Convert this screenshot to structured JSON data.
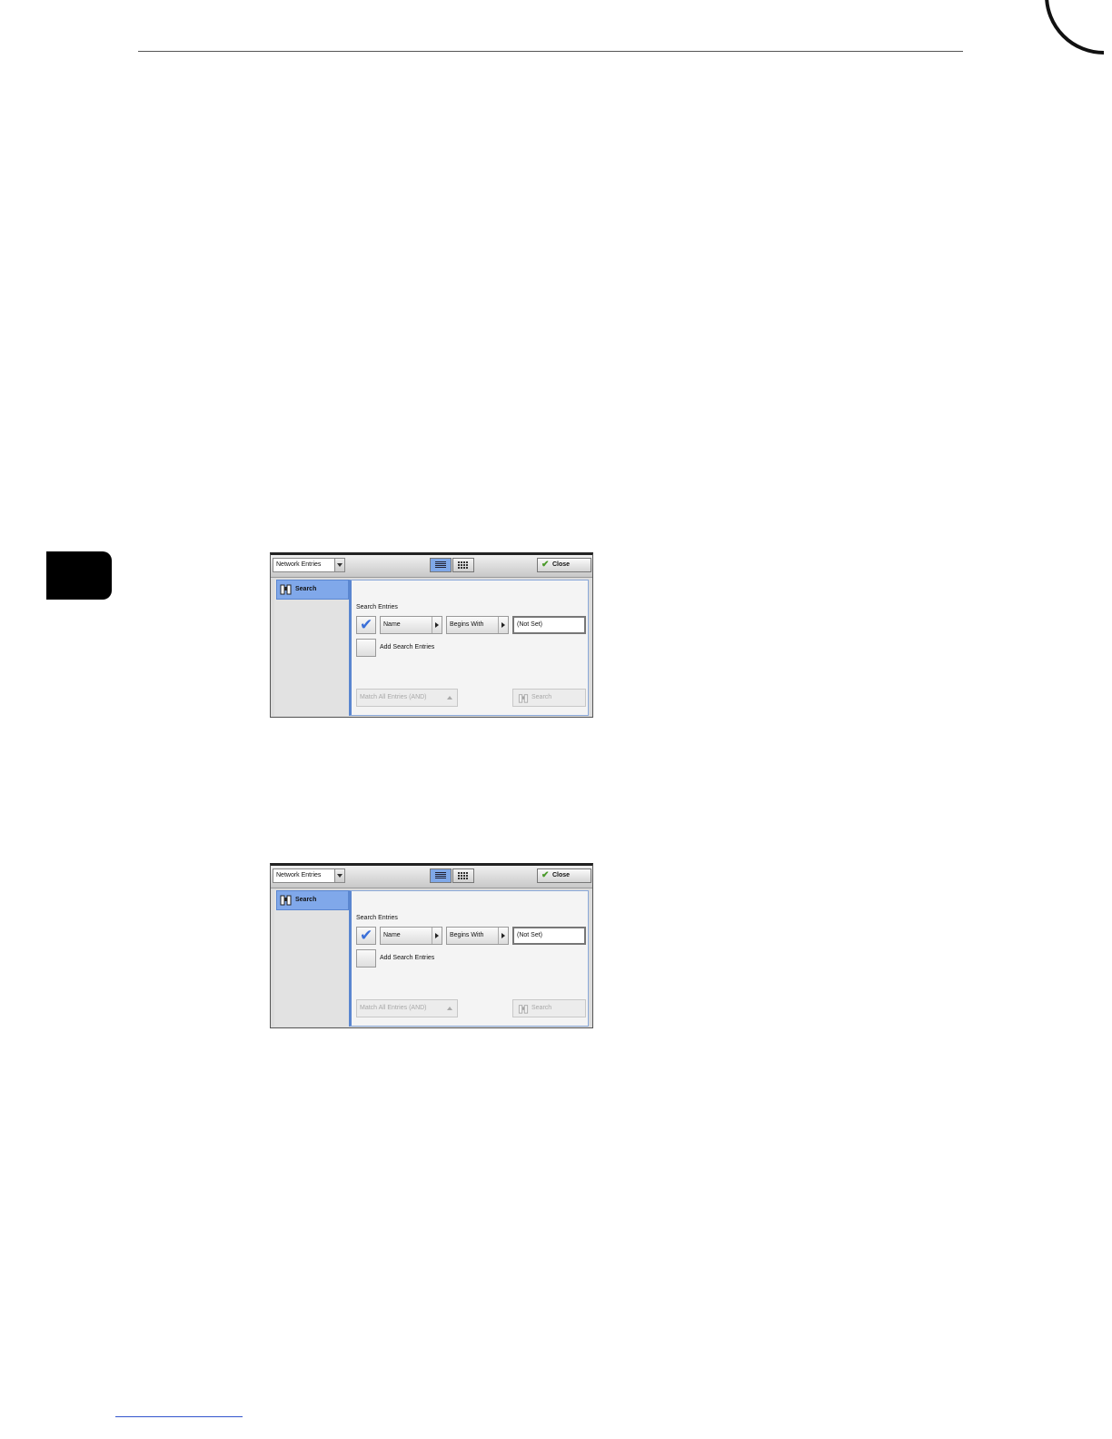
{
  "screens": [
    {
      "dropdown": "Network Entries",
      "close_label": "Close",
      "side_item": "Search",
      "section_title": "Search Entries",
      "field_name": "Name",
      "field_condition": "Begins With",
      "field_value": "(Not Set)",
      "add_label": "Add Search Entries",
      "match_label": "Match All Entries (AND)",
      "search_label": "Search"
    },
    {
      "dropdown": "Network Entries",
      "close_label": "Close",
      "side_item": "Search",
      "section_title": "Search Entries",
      "field_name": "Name",
      "field_condition": "Begins With",
      "field_value": "(Not Set)",
      "add_label": "Add Search Entries",
      "match_label": "Match All Entries (AND)",
      "search_label": "Search"
    }
  ],
  "icons": [
    "binoculars-icon",
    "checkmark-icon",
    "list-view-icon",
    "grid-view-icon"
  ]
}
